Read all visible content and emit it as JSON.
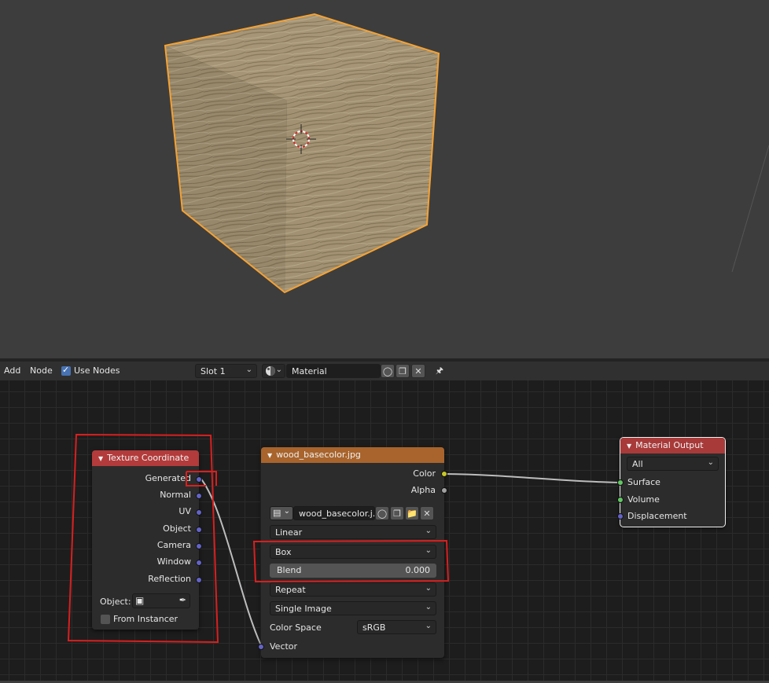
{
  "header": {
    "menu_add": "Add",
    "menu_node": "Node",
    "use_nodes_label": "Use Nodes",
    "use_nodes_checked": true,
    "slot_value": "Slot 1",
    "material_name": "Material",
    "icons": [
      "material-sphere-icon",
      "fake-user-shield-icon",
      "duplicate-icon",
      "unlink-x-icon",
      "pin-icon"
    ]
  },
  "nodes": {
    "texture_coordinate": {
      "title": "Texture Coordinate",
      "header_color": "#b33b3b",
      "outputs": [
        "Generated",
        "Normal",
        "UV",
        "Object",
        "Camera",
        "Window",
        "Reflection"
      ],
      "object_label": "Object:",
      "from_instancer_label": "From Instancer"
    },
    "image_texture": {
      "title": "wood_basecolor.jpg",
      "header_color": "#a8642c",
      "outputs": [
        "Color",
        "Alpha"
      ],
      "image_name": "wood_basecolor.j...",
      "interpolation": "Linear",
      "projection": "Box",
      "blend_label": "Blend",
      "blend_value": "0.000",
      "extension": "Repeat",
      "source": "Single Image",
      "color_space_label": "Color Space",
      "color_space": "sRGB",
      "input_vector": "Vector"
    },
    "material_output": {
      "title": "Material Output",
      "header_color": "#a83a3a",
      "target": "All",
      "inputs": [
        "Surface",
        "Volume",
        "Displacement"
      ]
    }
  },
  "colors": {
    "selection_outline": "#f5a234",
    "annotation_red": "#d91f1f",
    "link": "#bdbdbd"
  }
}
